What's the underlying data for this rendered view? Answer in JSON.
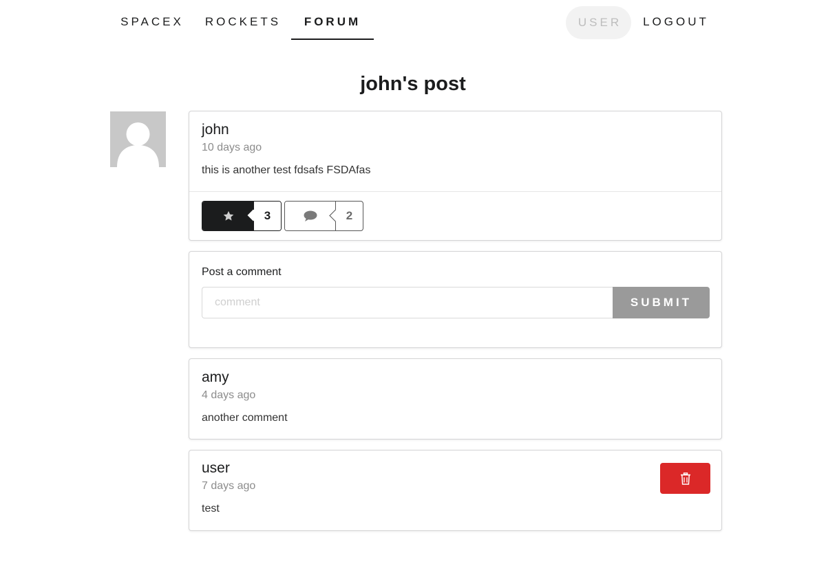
{
  "nav": {
    "spacex": "SPACEX",
    "rockets": "ROCKETS",
    "forum": "FORUM",
    "user": "USER",
    "logout": "LOGOUT"
  },
  "page": {
    "title": "john's post"
  },
  "post": {
    "author": "john",
    "time": "10 days ago",
    "text": "this is another test fdsafs FSDAfas",
    "star_icon": "star-icon",
    "star_count": "3",
    "comment_icon": "comment-icon",
    "comment_count": "2"
  },
  "comment_form": {
    "label": "Post a comment",
    "placeholder": "comment",
    "value": "",
    "submit_label": "SUBMIT"
  },
  "comments": [
    {
      "author": "amy",
      "time": "4 days ago",
      "text": "another comment"
    },
    {
      "author": "user",
      "time": "7 days ago",
      "text": "test",
      "delete_icon": "trash-icon"
    }
  ],
  "colors": {
    "primary_dark": "#1b1c1d",
    "delete_red": "#db2828",
    "submit_grey": "#9a9a9a",
    "avatar_grey": "#c8c8c8"
  }
}
